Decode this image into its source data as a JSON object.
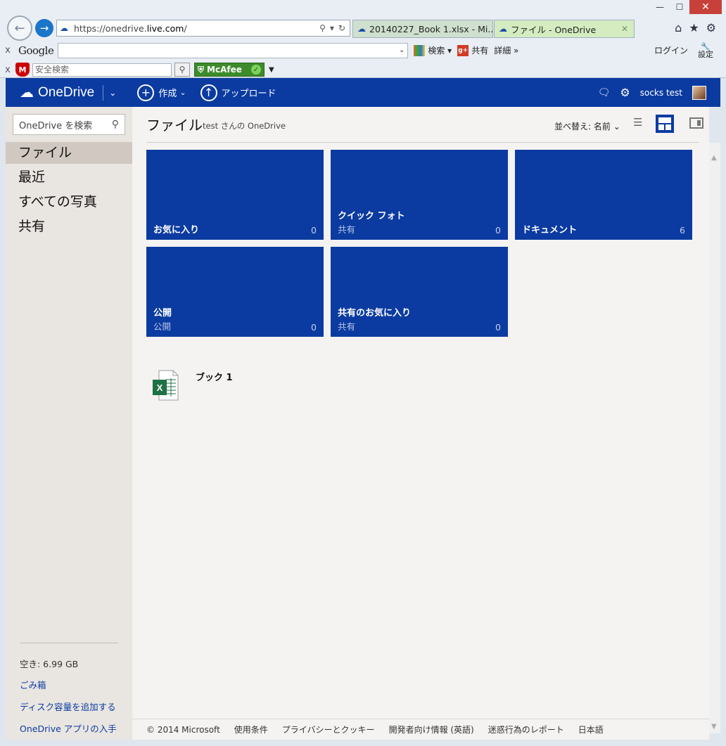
{
  "browser": {
    "url_prefix": "https://onedrive.",
    "url_domain": "live.com",
    "url_suffix": "/",
    "tabs": [
      {
        "title": "20140227_Book 1.xlsx - Mi..."
      },
      {
        "title": "ファイル - OneDrive"
      }
    ]
  },
  "googlebar": {
    "logo": "Google",
    "search_label": "検索",
    "share_label": "共有",
    "more_label": "詳細 »",
    "login_label": "ログイン",
    "settings_label": "設定"
  },
  "mcafeebar": {
    "placeholder": "安全検索",
    "badge": "McAfee"
  },
  "header": {
    "brand": "OneDrive",
    "create": "作成",
    "upload": "アップロード",
    "user": "socks test"
  },
  "sidebar": {
    "search_placeholder": "OneDrive を検索",
    "items": [
      {
        "label": "ファイル"
      },
      {
        "label": "最近"
      },
      {
        "label": "すべての写真"
      },
      {
        "label": "共有"
      }
    ],
    "free_space": "空き: 6.99 GB",
    "links": [
      {
        "label": "ごみ箱"
      },
      {
        "label": "ディスク容量を追加する"
      },
      {
        "label": "OneDrive アプリの入手"
      }
    ]
  },
  "main": {
    "title": "ファイル",
    "subtitle": "test さんの OneDrive",
    "sort_label": "並べ替え: 名前",
    "folders": [
      {
        "name": "お気に入り",
        "sub": "",
        "count": "0"
      },
      {
        "name": "クイック フォト",
        "sub": "共有",
        "count": "0"
      },
      {
        "name": "ドキュメント",
        "sub": "",
        "count": "6"
      },
      {
        "name": "公開",
        "sub": "公開",
        "count": "0"
      },
      {
        "name": "共有のお気に入り",
        "sub": "共有",
        "count": "0"
      }
    ],
    "files": [
      {
        "name": "ブック 1"
      }
    ]
  },
  "footer": {
    "items": [
      "© 2014 Microsoft",
      "使用条件",
      "プライバシーとクッキー",
      "開発者向け情報 (英語)",
      "迷惑行為のレポート",
      "日本語"
    ]
  },
  "colors": {
    "onedrive_blue": "#0b3ba1",
    "excel_green": "#1e7145"
  }
}
